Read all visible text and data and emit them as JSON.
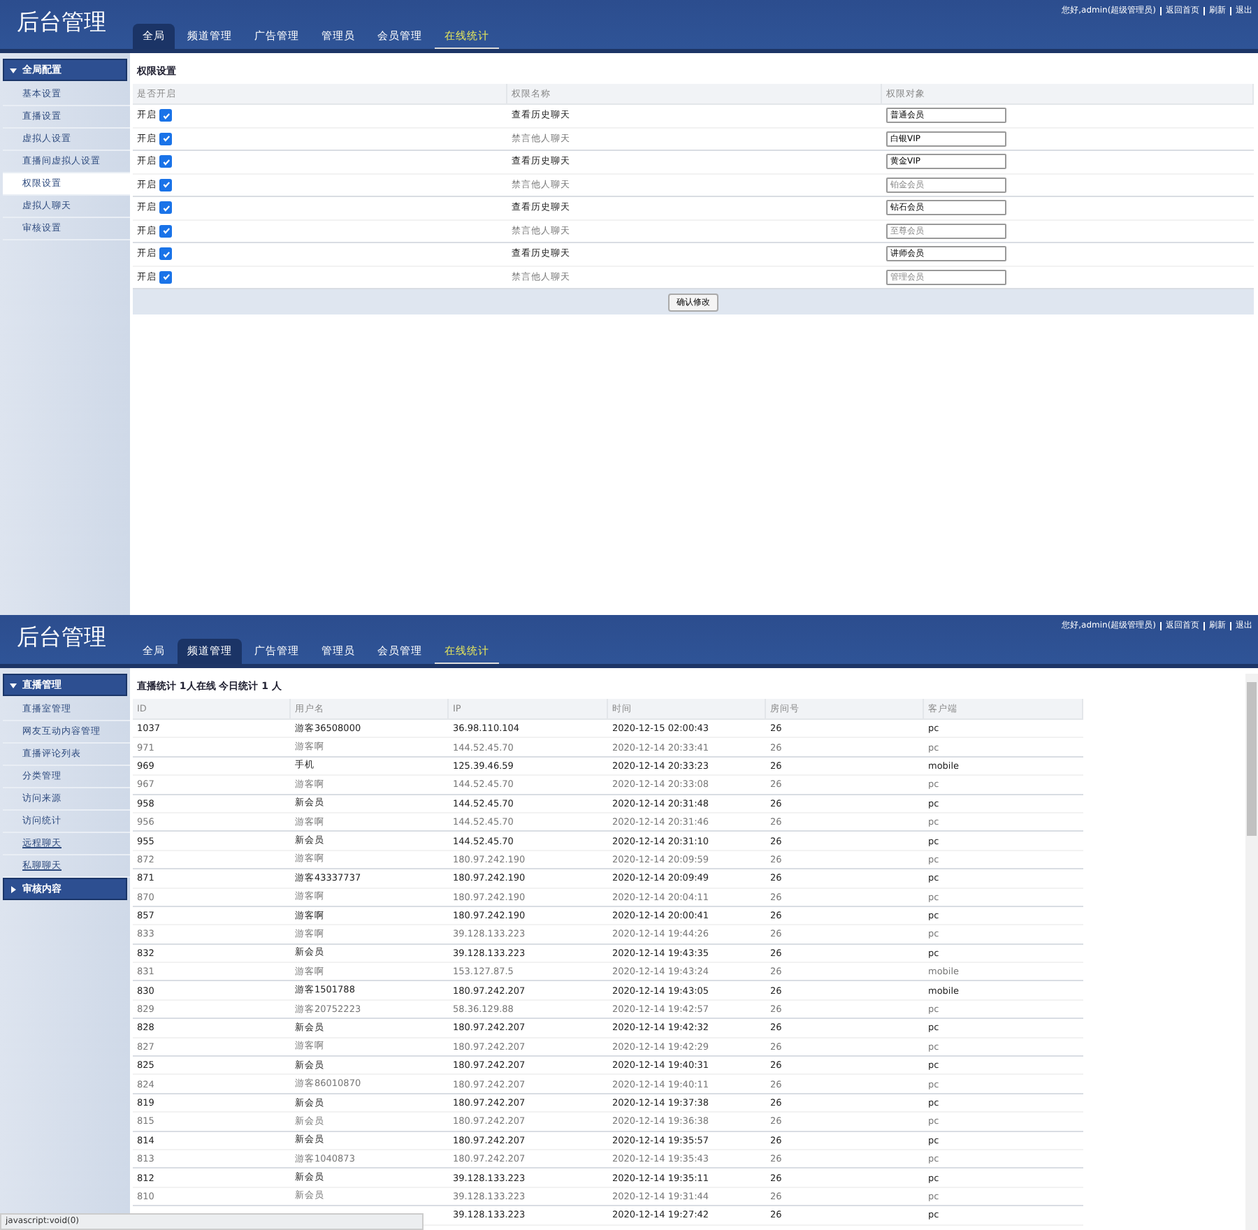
{
  "panels": [
    {
      "kind": "permissions",
      "header": {
        "title": "后台管理",
        "tabs": [
          {
            "label": "全局",
            "selected": true,
            "highlighted": false
          },
          {
            "label": "频道管理",
            "selected": false,
            "highlighted": false
          },
          {
            "label": "广告管理",
            "selected": false,
            "highlighted": false
          },
          {
            "label": "管理员",
            "selected": false,
            "highlighted": false
          },
          {
            "label": "会员管理",
            "selected": false,
            "highlighted": false
          },
          {
            "label": "在线统计",
            "selected": false,
            "highlighted": true
          }
        ],
        "user_links": [
          "您好,admin(超级管理员)",
          "返回首页",
          "刷新",
          "退出"
        ]
      },
      "sidebar": [
        {
          "label": "全局配置",
          "expanded": true,
          "items": [
            {
              "label": "基本设置",
              "selected": false,
              "underlined": false
            },
            {
              "label": "直播设置",
              "selected": false,
              "underlined": false
            },
            {
              "label": "虚拟人设置",
              "selected": false,
              "underlined": false
            },
            {
              "label": "直播间虚拟人设置",
              "selected": false,
              "underlined": false
            },
            {
              "label": "权限设置",
              "selected": true,
              "underlined": false
            },
            {
              "label": "虚拟人聊天",
              "selected": false,
              "underlined": false
            },
            {
              "label": "审核设置",
              "selected": false,
              "underlined": false
            }
          ]
        }
      ],
      "title": "权限设置",
      "columns": [
        "是否开启",
        "权限名称",
        "权限对象"
      ],
      "rows": [
        {
          "switch_label": "开启",
          "checked": true,
          "name": "查看历史聊天",
          "target": {
            "value": "普通会员"
          }
        },
        {
          "switch_label": "开启",
          "checked": true,
          "name": "禁言他人聊天",
          "target": {
            "value": "白银VIP"
          }
        },
        {
          "switch_label": "开启",
          "checked": true,
          "name": "查看历史聊天",
          "target": {
            "value": "黄金VIP"
          }
        },
        {
          "switch_label": "开启",
          "checked": true,
          "name": "禁言他人聊天",
          "target": {
            "placeholder": "铂金会员"
          }
        },
        {
          "switch_label": "开启",
          "checked": true,
          "name": "查看历史聊天",
          "target": {
            "value": "钻石会员"
          }
        },
        {
          "switch_label": "开启",
          "checked": true,
          "name": "禁言他人聊天",
          "target": {
            "placeholder": "至尊会员"
          }
        },
        {
          "switch_label": "开启",
          "checked": true,
          "name": "查看历史聊天",
          "target": {
            "value": "讲师会员"
          }
        },
        {
          "switch_label": "开启",
          "checked": true,
          "name": "禁言他人聊天",
          "target": {
            "placeholder": "管理会员"
          }
        }
      ],
      "button": "确认修改"
    },
    {
      "kind": "stats",
      "header": {
        "title": "后台管理",
        "tabs": [
          {
            "label": "全局",
            "selected": false,
            "highlighted": false
          },
          {
            "label": "频道管理",
            "selected": true,
            "highlighted": false
          },
          {
            "label": "广告管理",
            "selected": false,
            "highlighted": false
          },
          {
            "label": "管理员",
            "selected": false,
            "highlighted": false
          },
          {
            "label": "会员管理",
            "selected": false,
            "highlighted": false
          },
          {
            "label": "在线统计",
            "selected": false,
            "highlighted": true
          }
        ],
        "user_links": [
          "您好,admin(超级管理员)",
          "返回首页",
          "刷新",
          "退出"
        ]
      },
      "sidebar": [
        {
          "label": "直播管理",
          "expanded": true,
          "items": [
            {
              "label": "直播室管理",
              "selected": false,
              "underlined": false
            },
            {
              "label": "网友互动内容管理",
              "selected": false,
              "underlined": false
            },
            {
              "label": "直播评论列表",
              "selected": false,
              "underlined": false
            },
            {
              "label": "分类管理",
              "selected": false,
              "underlined": false
            },
            {
              "label": "访问来源",
              "selected": false,
              "underlined": false
            },
            {
              "label": "访问统计",
              "selected": false,
              "underlined": false
            },
            {
              "label": "远程聊天",
              "selected": false,
              "underlined": true
            },
            {
              "label": "私聊聊天",
              "selected": false,
              "underlined": true
            }
          ]
        },
        {
          "label": "审核内容",
          "expanded": false
        }
      ],
      "title": "直播统计 1人在线 今日统计 1 人",
      "columns": [
        "ID",
        "用户名",
        "IP",
        "时间",
        "房间号",
        "客户端"
      ],
      "rows": [
        [
          "1037",
          "游客36508000",
          "36.98.110.104",
          "2020-12-15 02:00:43",
          "26",
          "pc"
        ],
        [
          "971",
          "游客啊",
          "144.52.45.70",
          "2020-12-14 20:33:41",
          "26",
          "pc"
        ],
        [
          "969",
          "手机",
          "125.39.46.59",
          "2020-12-14 20:33:23",
          "26",
          "mobile"
        ],
        [
          "967",
          "游客啊",
          "144.52.45.70",
          "2020-12-14 20:33:08",
          "26",
          "pc"
        ],
        [
          "958",
          "新会员",
          "144.52.45.70",
          "2020-12-14 20:31:48",
          "26",
          "pc"
        ],
        [
          "956",
          "游客啊",
          "144.52.45.70",
          "2020-12-14 20:31:46",
          "26",
          "pc"
        ],
        [
          "955",
          "新会员",
          "144.52.45.70",
          "2020-12-14 20:31:10",
          "26",
          "pc"
        ],
        [
          "872",
          "游客啊",
          "180.97.242.190",
          "2020-12-14 20:09:59",
          "26",
          "pc"
        ],
        [
          "871",
          "游客43337737",
          "180.97.242.190",
          "2020-12-14 20:09:49",
          "26",
          "pc"
        ],
        [
          "870",
          "游客啊",
          "180.97.242.190",
          "2020-12-14 20:04:11",
          "26",
          "pc"
        ],
        [
          "857",
          "游客啊",
          "180.97.242.190",
          "2020-12-14 20:00:41",
          "26",
          "pc"
        ],
        [
          "833",
          "游客啊",
          "39.128.133.223",
          "2020-12-14 19:44:26",
          "26",
          "pc"
        ],
        [
          "832",
          "新会员",
          "39.128.133.223",
          "2020-12-14 19:43:35",
          "26",
          "pc"
        ],
        [
          "831",
          "游客啊",
          "153.127.87.5",
          "2020-12-14 19:43:24",
          "26",
          "mobile"
        ],
        [
          "830",
          "游客1501788",
          "180.97.242.207",
          "2020-12-14 19:43:05",
          "26",
          "mobile"
        ],
        [
          "829",
          "游客20752223",
          "58.36.129.88",
          "2020-12-14 19:42:57",
          "26",
          "pc"
        ],
        [
          "828",
          "新会员",
          "180.97.242.207",
          "2020-12-14 19:42:32",
          "26",
          "pc"
        ],
        [
          "827",
          "游客啊",
          "180.97.242.207",
          "2020-12-14 19:42:29",
          "26",
          "pc"
        ],
        [
          "825",
          "新会员",
          "180.97.242.207",
          "2020-12-14 19:40:31",
          "26",
          "pc"
        ],
        [
          "824",
          "游客86010870",
          "180.97.242.207",
          "2020-12-14 19:40:11",
          "26",
          "pc"
        ],
        [
          "819",
          "新会员",
          "180.97.242.207",
          "2020-12-14 19:37:38",
          "26",
          "pc"
        ],
        [
          "815",
          "新会员",
          "180.97.242.207",
          "2020-12-14 19:36:38",
          "26",
          "pc"
        ],
        [
          "814",
          "新会员",
          "180.97.242.207",
          "2020-12-14 19:35:57",
          "26",
          "pc"
        ],
        [
          "813",
          "游客1040873",
          "180.97.242.207",
          "2020-12-14 19:35:43",
          "26",
          "pc"
        ],
        [
          "812",
          "新会员",
          "39.128.133.223",
          "2020-12-14 19:35:11",
          "26",
          "pc"
        ],
        [
          "810",
          "新会员",
          "39.128.133.223",
          "2020-12-14 19:31:44",
          "26",
          "pc"
        ],
        [
          null,
          null,
          "39.128.133.223",
          "2020-12-14 19:27:42",
          "26",
          "pc"
        ]
      ]
    }
  ],
  "status_bar": "javascript:void(0)"
}
